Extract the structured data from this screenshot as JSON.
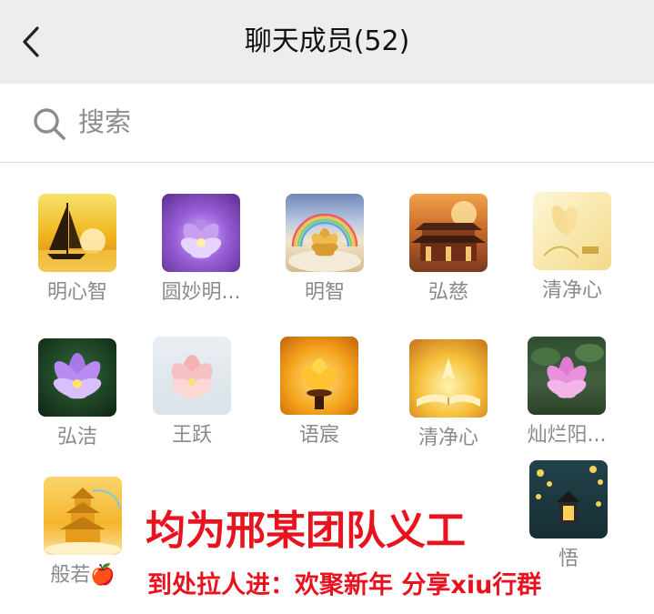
{
  "header": {
    "title": "聊天成员(52)"
  },
  "search": {
    "placeholder": "搜索"
  },
  "members": [
    {
      "name": "明心智",
      "avatar": "sailboat-sunset"
    },
    {
      "name": "圆妙明...",
      "avatar": "purple-lotus-glow"
    },
    {
      "name": "明智",
      "avatar": "golden-lotus-rainbow"
    },
    {
      "name": "弘慈",
      "avatar": "temple-sunset"
    },
    {
      "name": "清净心",
      "avatar": "light-lotus-painting"
    },
    {
      "name": "弘洁",
      "avatar": "purple-lotus-dark"
    },
    {
      "name": "王跃",
      "avatar": "pink-lotus"
    },
    {
      "name": "语宸",
      "avatar": "golden-candle-lotus"
    },
    {
      "name": "清净心",
      "avatar": "glowing-book"
    },
    {
      "name": "灿烂阳...",
      "avatar": "purple-lotus-leaves"
    },
    {
      "name": "般若🍎",
      "avatar": "golden-pagoda"
    },
    {
      "name": "悟",
      "avatar": "lantern-blossoms"
    }
  ],
  "overlay": {
    "line1": "均为邢某团队义工",
    "line2": "到处拉人进：欢聚新年 分享xiu行群",
    "color": "#e8131f"
  }
}
